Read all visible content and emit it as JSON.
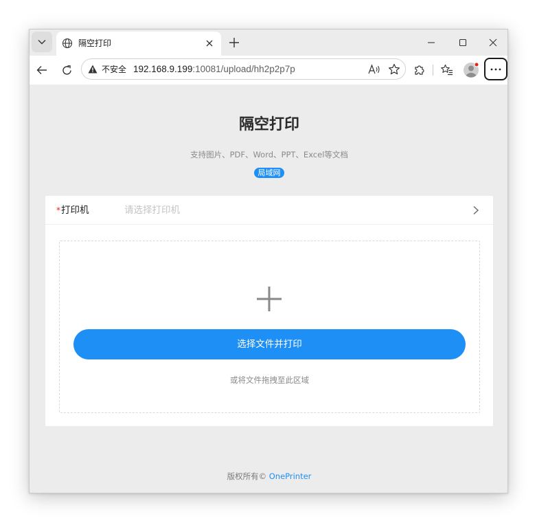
{
  "browser": {
    "tab_title": "隔空打印",
    "security_label": "不安全",
    "url_host": "192.168.9.199",
    "url_rest": ":10081/upload/hh2p2p7p",
    "icons": {
      "tab_dropdown": "chevron-down-icon",
      "tab_favicon": "globe-icon",
      "tab_close": "close-icon",
      "new_tab": "plus-icon",
      "minimize": "minimize-icon",
      "maximize": "maximize-icon",
      "close_window": "close-icon",
      "back": "back-arrow-icon",
      "refresh": "refresh-icon",
      "insecure": "warning-icon",
      "read_aloud": "read-aloud-icon",
      "favorite": "star-icon",
      "extensions": "puzzle-icon",
      "favorites_list": "favorites-icon",
      "profile": "profile-avatar-icon",
      "more": "more-icon"
    }
  },
  "page": {
    "title": "隔空打印",
    "subtitle": "支持图片、PDF、Word、PPT、Excel等文档",
    "badge": "局域网",
    "printer": {
      "required_mark": "*",
      "label": "打印机",
      "placeholder": "请选择打印机"
    },
    "upload": {
      "button_label": "选择文件并打印",
      "drag_hint": "或将文件拖拽至此区域"
    },
    "footer": {
      "copyright": "版权所有© ",
      "link": "OnePrinter"
    }
  },
  "colors": {
    "accent": "#1e8ff5",
    "required": "#e2231a",
    "page_background": "#ececec"
  }
}
